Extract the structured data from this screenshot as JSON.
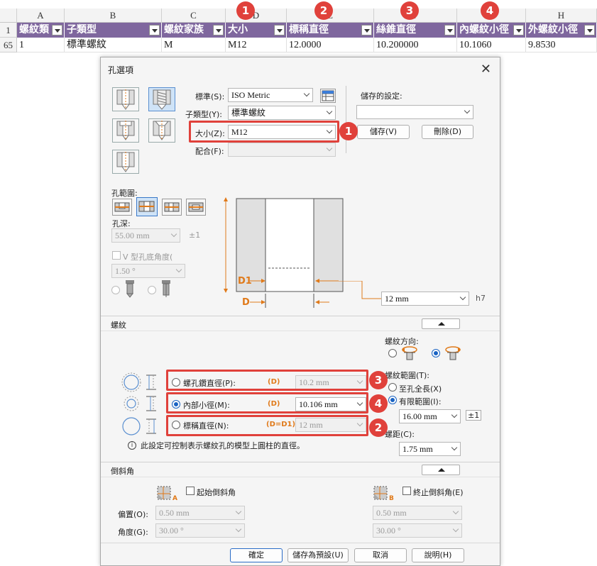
{
  "sheet": {
    "col_letters": [
      "A",
      "B",
      "C",
      "D",
      "E",
      "F",
      "G",
      "H"
    ],
    "row_numbers": [
      "1",
      "65"
    ],
    "headers": [
      "螺紋類",
      "子類型",
      "螺紋家族",
      "大小",
      "標稱直徑",
      "絲錐直徑",
      "內螺紋小徑",
      "外螺紋小徑"
    ],
    "row65": [
      "1",
      "標準螺紋",
      "M",
      "M12",
      "12.0000",
      "10.200000",
      "10.1060",
      "9.8530"
    ],
    "badges": [
      "1",
      "2",
      "3",
      "4"
    ]
  },
  "dialog": {
    "title": "孔選項",
    "standard_label": "標準(S):",
    "standard_value": "ISO Metric",
    "subtype_label": "子類型(Y):",
    "subtype_value": "標準螺紋",
    "size_label": "大小(Z):",
    "size_value": "M12",
    "fit_label": "配合(F):",
    "fit_value": "",
    "saved_label": "儲存的設定:",
    "saved_value": "",
    "save_btn": "儲存(V)",
    "delete_btn": "刪除(D)",
    "hole_range_label": "孔範圍:",
    "hole_depth_label": "孔深:",
    "hole_depth_value": "55.00 mm",
    "pm": "±1",
    "v_angle_label": "V 型孔底角度(",
    "v_angle_value": "1.50 °",
    "diagram_d1": "D1",
    "diagram_d": "D",
    "tolerance_value": "12 mm",
    "tolerance_class": "h7",
    "thread_section": "螺紋",
    "thread_dir_label": "螺紋方向:",
    "thread_range_label": "螺紋範圍(T):",
    "full_length": "至孔全長(X)",
    "finite_range": "有限範圍(I):",
    "finite_value": "16.00 mm",
    "pitch_label": "螺距(C):",
    "pitch_value": "1.75 mm",
    "tap_drill_label": "螺孔鑽直徑(P):",
    "tap_drill_tag": "(D)",
    "tap_drill_value": "10.2 mm",
    "minor_label": "內部小徑(M):",
    "minor_tag": "(D)",
    "minor_value": "10.106 mm",
    "nominal_label": "標稱直徑(N):",
    "nominal_tag": "(D=D1)",
    "nominal_value": "12 mm",
    "info_text": "此設定可控制表示螺紋孔的模型上圓柱的直徑。",
    "chamfer_section": "倒斜角",
    "start_chamfer": "起始倒斜角",
    "end_chamfer": "終止倒斜角(E)",
    "offset_label": "偏置(O):",
    "angle_label": "角度(G):",
    "offset_value_a": "0.50 mm",
    "angle_value_a": "30.00 °",
    "offset_value_b": "0.50 mm",
    "angle_value_b": "30.00 °",
    "chamfer_a": "A",
    "chamfer_b": "B",
    "ok_btn": "確定",
    "save_default_btn": "儲存為預設(U)",
    "cancel_btn": "取消",
    "help_btn": "說明(H)",
    "accent": "#e0413b",
    "header_color": "#7f679e"
  }
}
